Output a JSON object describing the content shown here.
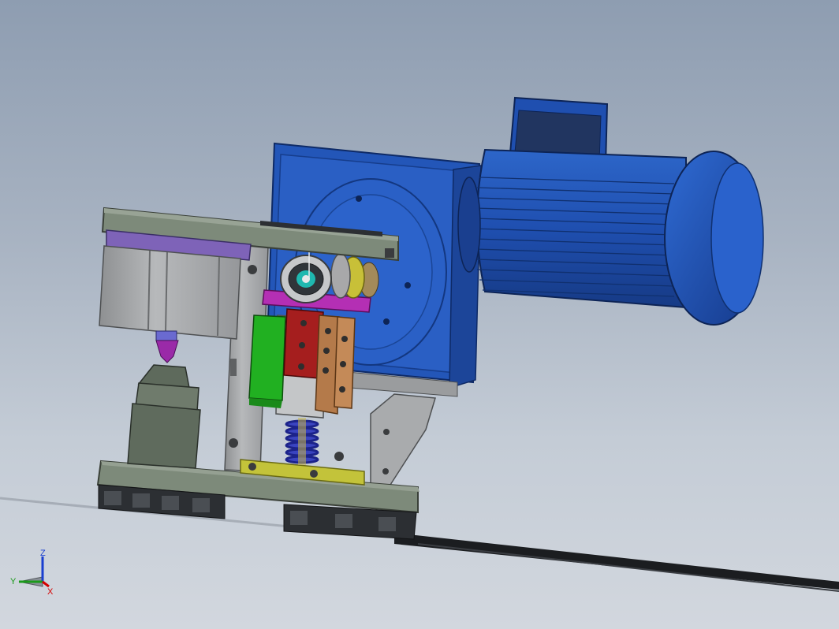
{
  "viewport": {
    "background_top": "#8e9db1",
    "background_bottom": "#d2d7de"
  },
  "model": {
    "parts": [
      {
        "name": "gear-motor",
        "color": "#1f4fb0"
      },
      {
        "name": "gearbox-housing",
        "color": "#2356b8"
      },
      {
        "name": "cylinder-block",
        "color": "#a6a8aa"
      },
      {
        "name": "top-plate",
        "color": "#7d8a7a"
      },
      {
        "name": "base-plate",
        "color": "#7d8a7a"
      },
      {
        "name": "spring",
        "color": "#2b35a8"
      },
      {
        "name": "red-block",
        "color": "#a51e1e"
      },
      {
        "name": "green-block",
        "color": "#21b021"
      },
      {
        "name": "copper-clamp",
        "color": "#b47a4a"
      },
      {
        "name": "magenta-bracket",
        "color": "#b42fb4"
      },
      {
        "name": "yellow-plate",
        "color": "#c3c33a"
      }
    ]
  },
  "triad": {
    "x_label": "X",
    "y_label": "Y",
    "z_label": "Z",
    "x_color": "#d40000",
    "y_color": "#1a9a1a",
    "z_color": "#1a3fd0"
  }
}
